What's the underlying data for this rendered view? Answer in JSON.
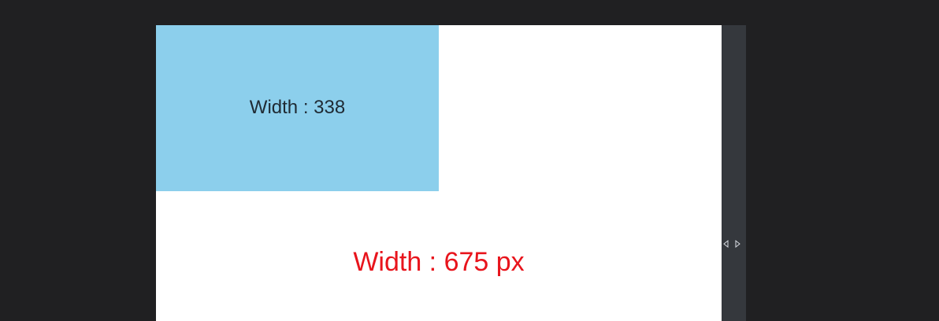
{
  "blue_box": {
    "label": "Width : 338"
  },
  "viewport": {
    "width_label": "Width : 675 px"
  },
  "resize_handle": {
    "icon": "resize-horizontal-icon"
  },
  "colors": {
    "background": "#202022",
    "viewport": "#ffffff",
    "blue_box": "#8ccfec",
    "label_text": "#1f2a33",
    "width_label": "#e8141c",
    "handle": "#35383d"
  }
}
